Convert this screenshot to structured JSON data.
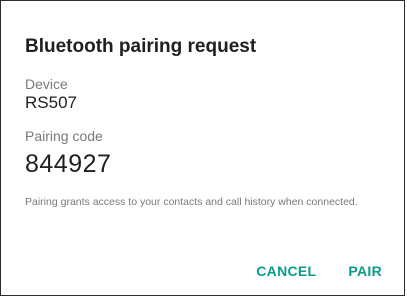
{
  "dialog": {
    "title": "Bluetooth pairing request",
    "device_label": "Device",
    "device_name": "RS507",
    "pairing_code_label": "Pairing code",
    "pairing_code": "844927",
    "message": "Pairing grants access to your contacts and call history when connected.",
    "cancel_label": "CANCEL",
    "pair_label": "PAIR",
    "accent_color": "#0a9b8b"
  }
}
